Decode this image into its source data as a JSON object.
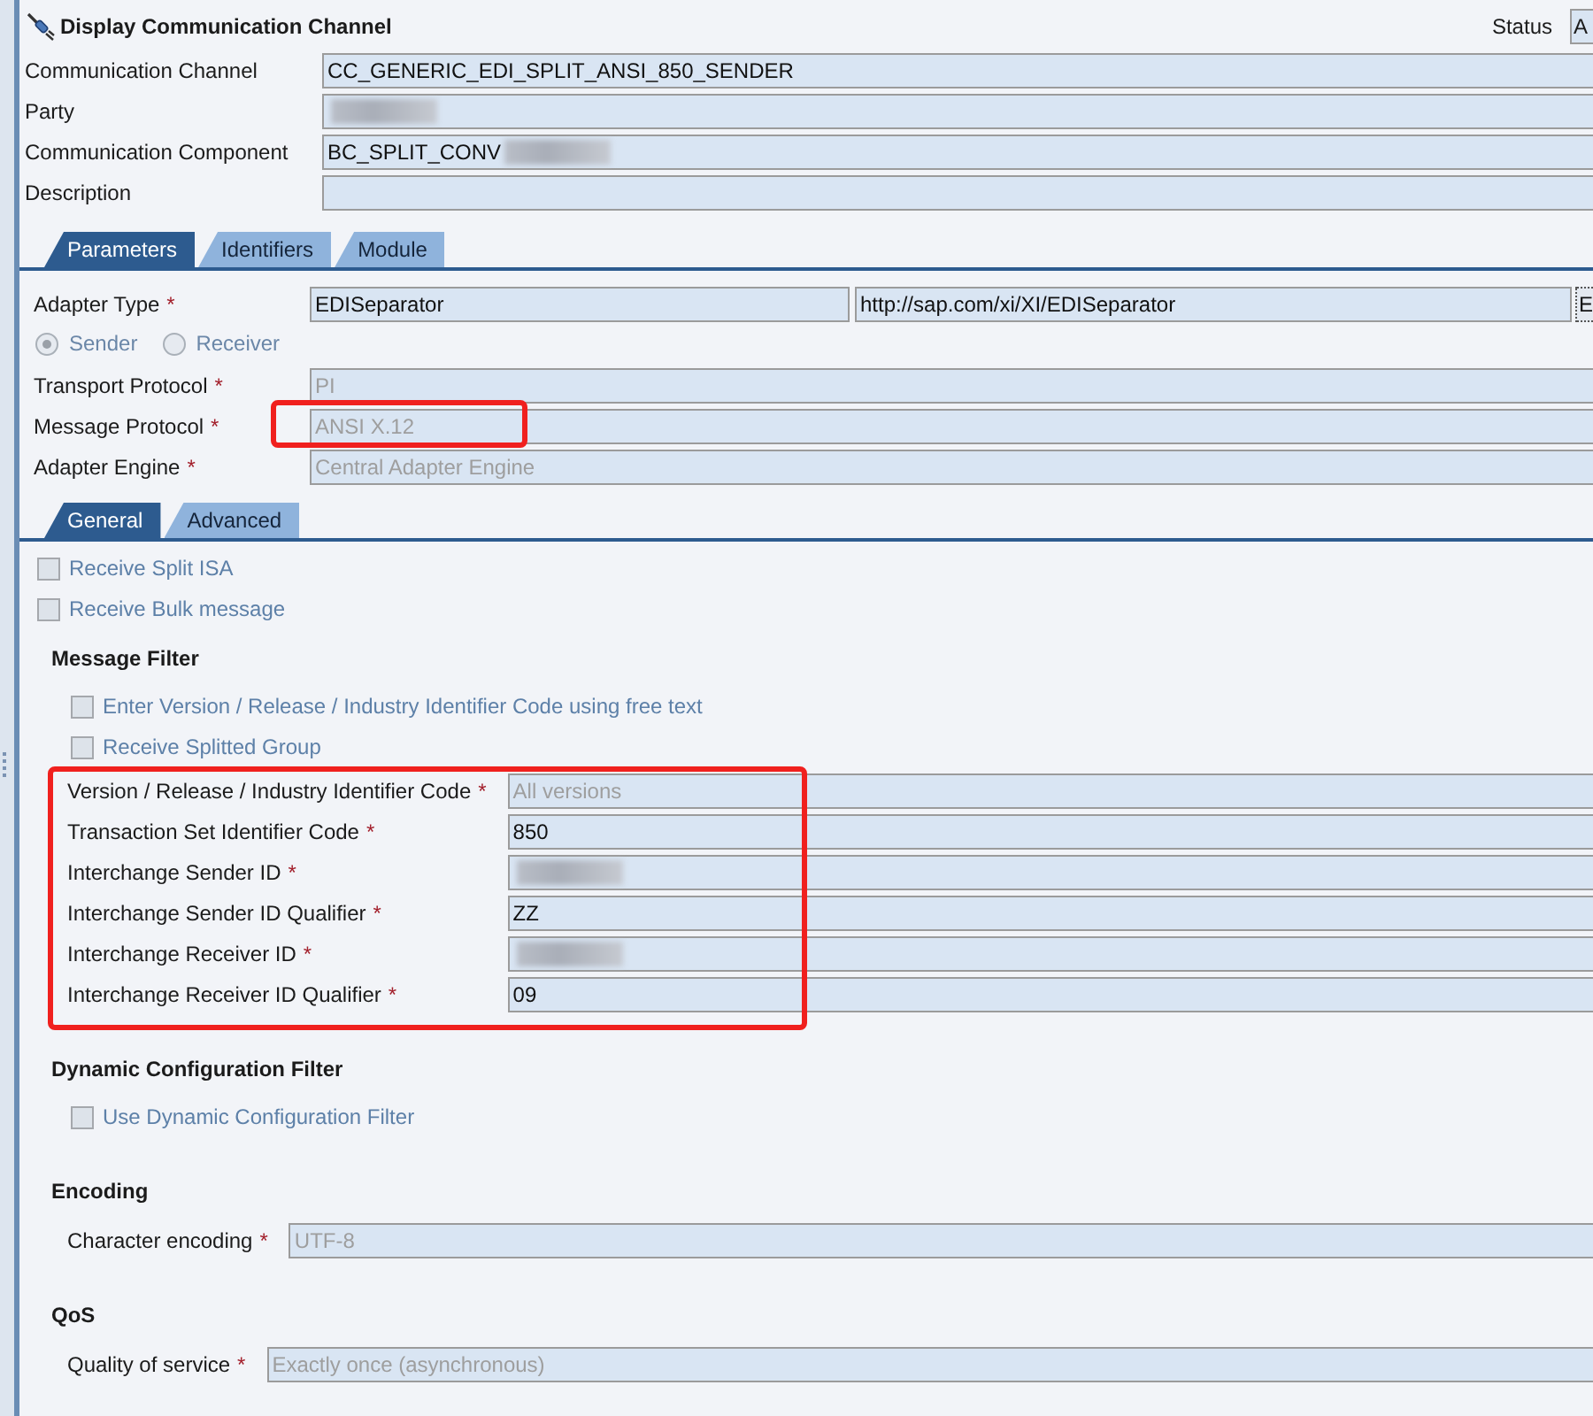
{
  "window": {
    "title": "Display Communication Channel",
    "status": {
      "label": "Status",
      "value": "A"
    }
  },
  "header_fields": [
    {
      "label": "Communication Channel",
      "value": "CC_GENERIC_EDI_SPLIT_ANSI_850_SENDER",
      "redacted": false
    },
    {
      "label": "Party",
      "redacted": true
    },
    {
      "label": "Communication Component",
      "value": "BC_SPLIT_CONV",
      "redacted": true
    },
    {
      "label": "Description",
      "redacted": false
    }
  ],
  "tabs": [
    {
      "label": "Parameters",
      "selected": true
    },
    {
      "label": "Identifiers",
      "selected": false
    },
    {
      "label": "Module",
      "selected": false
    }
  ],
  "parameters": {
    "adapter_type": {
      "label": "Adapter Type",
      "mark": "*",
      "value": "EDISeparator",
      "namespace": "http://sap.com/xi/XI/EDISeparator",
      "help_button": "E"
    },
    "direction": [
      {
        "label": "Sender",
        "selected": true,
        "disabled": true
      },
      {
        "label": "Receiver",
        "selected": false,
        "disabled": true
      }
    ],
    "fields": [
      {
        "label": "Transport Protocol",
        "mark": "*",
        "value": "PI",
        "disabled": true,
        "highlighted": false
      },
      {
        "label": "Message Protocol",
        "mark": "*",
        "value": "ANSI X.12",
        "disabled": true,
        "highlighted": true
      },
      {
        "label": "Adapter Engine",
        "mark": "*",
        "value": "Central Adapter Engine",
        "disabled": true,
        "highlighted": false
      }
    ]
  },
  "subtabs": [
    {
      "label": "General",
      "selected": true
    },
    {
      "label": "Advanced",
      "selected": false
    }
  ],
  "general": {
    "options": [
      {
        "label": "Receive Split ISA",
        "checked": false,
        "disabled": true
      },
      {
        "label": "Receive Bulk message",
        "checked": false,
        "disabled": true
      }
    ],
    "sections": [
      {
        "title": "Message Filter",
        "highlighted": true,
        "options": [
          {
            "label": "Enter Version / Release / Industry Identifier Code using free text",
            "checked": false,
            "disabled": true
          },
          {
            "label": "Receive Splitted Group",
            "checked": false,
            "disabled": true
          }
        ],
        "fields": [
          {
            "label": "Version / Release / Industry Identifier Code",
            "mark": "*",
            "value": "All versions",
            "disabled": true,
            "redacted": false
          },
          {
            "label": "Transaction Set Identifier Code",
            "mark": "*",
            "value": "850",
            "disabled": false,
            "redacted": false
          },
          {
            "label": "Interchange Sender ID",
            "mark": "*",
            "disabled": false,
            "redacted": true
          },
          {
            "label": "Interchange Sender ID Qualifier",
            "mark": "*",
            "value": "ZZ",
            "disabled": false,
            "redacted": false
          },
          {
            "label": "Interchange Receiver ID",
            "mark": "*",
            "disabled": false,
            "redacted": true
          },
          {
            "label": "Interchange Receiver ID Qualifier",
            "mark": "*",
            "value": "09",
            "disabled": false,
            "redacted": false
          }
        ]
      },
      {
        "title": "Dynamic Configuration Filter",
        "highlighted": false,
        "options": [
          {
            "label": "Use Dynamic Configuration Filter",
            "checked": false,
            "disabled": true
          }
        ]
      },
      {
        "title": "Encoding",
        "highlighted": false,
        "fields": [
          {
            "label": "Character encoding",
            "mark": "*",
            "value": "UTF-8",
            "disabled": true,
            "redacted": false
          }
        ]
      },
      {
        "title": "QoS",
        "highlighted": false,
        "fields": [
          {
            "label": "Quality of service",
            "mark": "*",
            "value": "Exactly once (asynchronous)",
            "disabled": true,
            "redacted": false
          }
        ]
      }
    ]
  }
}
